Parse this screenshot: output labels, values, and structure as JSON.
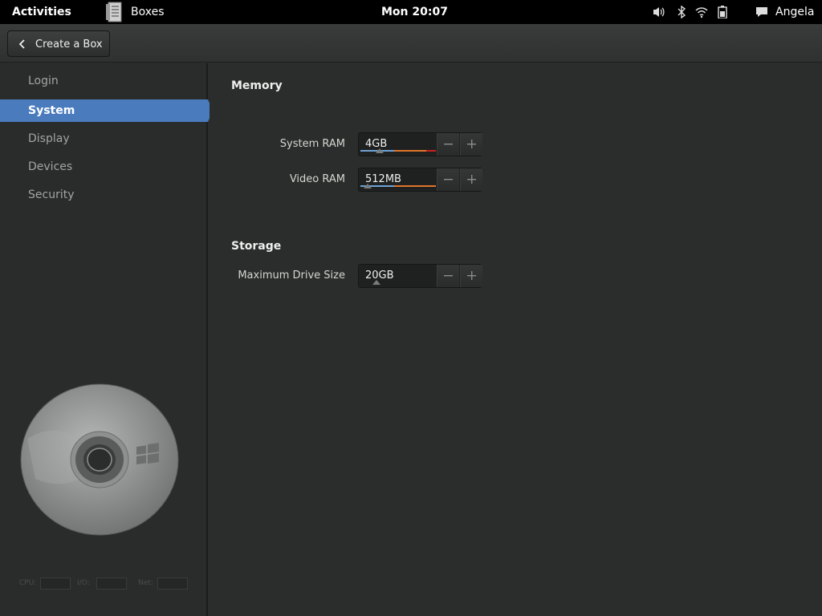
{
  "topbar": {
    "activities": "Activities",
    "app_name": "Boxes",
    "clock": "Mon 20:07",
    "user": "Angela",
    "icons": [
      "boxes-app-icon",
      "volume-icon",
      "bluetooth-icon",
      "wifi-icon",
      "battery-icon",
      "chat-icon"
    ]
  },
  "header": {
    "back_label": "Create a Box"
  },
  "sidebar": {
    "items": [
      {
        "label": "Login",
        "active": false
      },
      {
        "label": "System",
        "active": true
      },
      {
        "label": "Display",
        "active": false
      },
      {
        "label": "Devices",
        "active": false
      },
      {
        "label": "Security",
        "active": false
      }
    ],
    "stats": {
      "cpu_label": "CPU:",
      "io_label": "I/O:",
      "net_label": "Net:"
    }
  },
  "main": {
    "memory": {
      "title": "Memory",
      "system_ram": {
        "label": "System RAM",
        "value": "4GB",
        "level": 0.26
      },
      "video_ram": {
        "label": "Video RAM",
        "value": "512MB",
        "level": 0.1
      }
    },
    "storage": {
      "title": "Storage",
      "max_drive": {
        "label": "Maximum Drive Size",
        "value": "20GB",
        "level": 0.21
      }
    }
  },
  "colors": {
    "accent": "#4a7cbd",
    "bar_blue": "#6fa3d6",
    "bar_orange": "#e0762a",
    "bar_red": "#cc2020"
  }
}
